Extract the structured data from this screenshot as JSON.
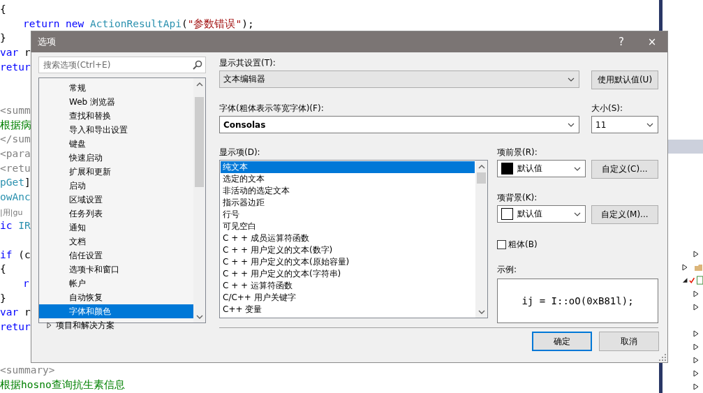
{
  "editor": {
    "lines": [
      {
        "kind": "code",
        "tokens": [
          {
            "text": "{",
            "kind": "plain"
          }
        ]
      },
      {
        "kind": "code",
        "indented": true,
        "tokens": [
          {
            "text": "return",
            "kind": "keyword"
          },
          {
            "text": " new",
            "kind": "keyword"
          },
          {
            "text": " ActionResultApi",
            "kind": "type"
          },
          {
            "text": "(",
            "kind": "plain"
          },
          {
            "text": "\"参数错误\"",
            "kind": "string"
          },
          {
            "text": ");",
            "kind": "plain"
          }
        ]
      },
      {
        "kind": "code",
        "tokens": [
          {
            "text": "}",
            "kind": "plain"
          }
        ]
      },
      {
        "kind": "code",
        "tokens": [
          {
            "text": "var",
            "kind": "keyword"
          },
          {
            "text": " r",
            "kind": "plain"
          }
        ]
      },
      {
        "kind": "code",
        "tokens": [
          {
            "text": "retur",
            "kind": "keyword"
          }
        ]
      },
      {
        "kind": "blank"
      },
      {
        "kind": "blank"
      },
      {
        "kind": "code",
        "tokens": [
          {
            "text": "<summ",
            "kind": "doc"
          }
        ]
      },
      {
        "kind": "code",
        "tokens": [
          {
            "text": "根据病",
            "kind": "comment"
          }
        ]
      },
      {
        "kind": "code",
        "tokens": [
          {
            "text": "</sum",
            "kind": "doc"
          }
        ]
      },
      {
        "kind": "code",
        "tokens": [
          {
            "text": "<para",
            "kind": "doc"
          }
        ]
      },
      {
        "kind": "code",
        "tokens": [
          {
            "text": "<retu",
            "kind": "doc"
          }
        ]
      },
      {
        "kind": "code",
        "tokens": [
          {
            "text": "pGet",
            "kind": "type"
          },
          {
            "text": "]",
            "kind": "plain"
          }
        ]
      },
      {
        "kind": "code",
        "tokens": [
          {
            "text": "owAnc",
            "kind": "type"
          }
        ]
      },
      {
        "kind": "code",
        "tokens": [
          {
            "text": "|用|gu",
            "kind": "lens"
          }
        ]
      },
      {
        "kind": "code",
        "tokens": [
          {
            "text": "ic",
            "kind": "keyword"
          },
          {
            "text": " IR",
            "kind": "type"
          }
        ]
      },
      {
        "kind": "blank"
      },
      {
        "kind": "code",
        "tokens": [
          {
            "text": "if",
            "kind": "keyword"
          },
          {
            "text": " (c",
            "kind": "plain"
          }
        ]
      },
      {
        "kind": "code",
        "tokens": [
          {
            "text": "{",
            "kind": "plain"
          }
        ]
      },
      {
        "kind": "code",
        "indented": true,
        "tokens": [
          {
            "text": "r",
            "kind": "keyword"
          }
        ]
      },
      {
        "kind": "code",
        "tokens": [
          {
            "text": "}",
            "kind": "plain"
          }
        ]
      },
      {
        "kind": "code",
        "tokens": [
          {
            "text": "var",
            "kind": "keyword"
          },
          {
            "text": " r",
            "kind": "plain"
          }
        ]
      },
      {
        "kind": "code",
        "tokens": [
          {
            "text": "retur",
            "kind": "keyword"
          }
        ]
      },
      {
        "kind": "blank"
      },
      {
        "kind": "blank"
      },
      {
        "kind": "code",
        "tokens": [
          {
            "text": "<summary>",
            "kind": "doc"
          }
        ]
      },
      {
        "kind": "code",
        "tokens": [
          {
            "text": "根据hosno查询抗生素信息",
            "kind": "comment"
          }
        ]
      }
    ]
  },
  "dialog": {
    "title": "选项",
    "help_button": "?",
    "close_button": "×",
    "search": {
      "placeholder": "搜索选项(Ctrl+E)"
    },
    "tree": [
      {
        "label": "常规",
        "kind": "leaf",
        "selected": false
      },
      {
        "label": "Web 浏览器",
        "kind": "leaf",
        "selected": false
      },
      {
        "label": "查找和替换",
        "kind": "leaf",
        "selected": false
      },
      {
        "label": "导入和导出设置",
        "kind": "leaf",
        "selected": false
      },
      {
        "label": "键盘",
        "kind": "leaf",
        "selected": false
      },
      {
        "label": "快速启动",
        "kind": "leaf",
        "selected": false
      },
      {
        "label": "扩展和更新",
        "kind": "leaf",
        "selected": false
      },
      {
        "label": "启动",
        "kind": "leaf",
        "selected": false
      },
      {
        "label": "区域设置",
        "kind": "leaf",
        "selected": false
      },
      {
        "label": "任务列表",
        "kind": "leaf",
        "selected": false
      },
      {
        "label": "通知",
        "kind": "leaf",
        "selected": false
      },
      {
        "label": "文档",
        "kind": "leaf",
        "selected": false
      },
      {
        "label": "信任设置",
        "kind": "leaf",
        "selected": false
      },
      {
        "label": "选项卡和窗口",
        "kind": "leaf",
        "selected": false
      },
      {
        "label": "帐户",
        "kind": "leaf",
        "selected": false
      },
      {
        "label": "自动恢复",
        "kind": "leaf",
        "selected": false
      },
      {
        "label": "字体和颜色",
        "kind": "leaf",
        "selected": true
      },
      {
        "label": "项目和解决方案",
        "kind": "group",
        "expanded": false,
        "selected": false
      }
    ],
    "show_settings_for": {
      "label": "显示其设置(T):",
      "value": "文本编辑器"
    },
    "use_defaults_button": "使用默认值(U)",
    "font": {
      "label": "字体(粗体表示等宽字体)(F):",
      "value": "Consolas"
    },
    "size": {
      "label": "大小(S):",
      "value": "11"
    },
    "display_items": {
      "label": "显示项(D):",
      "items": [
        {
          "label": "纯文本",
          "selected": true
        },
        {
          "label": "选定的文本",
          "selected": false
        },
        {
          "label": "非活动的选定文本",
          "selected": false
        },
        {
          "label": "指示器边距",
          "selected": false
        },
        {
          "label": "行号",
          "selected": false
        },
        {
          "label": "可见空白",
          "selected": false
        },
        {
          "label": "C + + 成员运算符函数",
          "selected": false
        },
        {
          "label": "C + + 用户定义的文本(数字)",
          "selected": false
        },
        {
          "label": "C + + 用户定义的文本(原始容量)",
          "selected": false
        },
        {
          "label": "C + + 用户定义的文本(字符串)",
          "selected": false
        },
        {
          "label": "C + + 运算符函数",
          "selected": false
        },
        {
          "label": "C/C++ 用户关键字",
          "selected": false
        },
        {
          "label": "C++ 变量",
          "selected": false
        }
      ]
    },
    "item_foreground": {
      "label": "项前景(R):",
      "value": "默认值",
      "color": "#000000",
      "button": "自定义(C)..."
    },
    "item_background": {
      "label": "项背景(K):",
      "value": "默认值",
      "color": "#ffffff",
      "button": "自定义(M)..."
    },
    "bold": {
      "label": "粗体(B)",
      "checked": false
    },
    "sample": {
      "label": "示例:",
      "text": "ij = I::oO(0xB81l);"
    },
    "buttons": [
      {
        "label": "确定",
        "kind": "default"
      },
      {
        "label": "取消",
        "kind": "normal"
      }
    ]
  }
}
